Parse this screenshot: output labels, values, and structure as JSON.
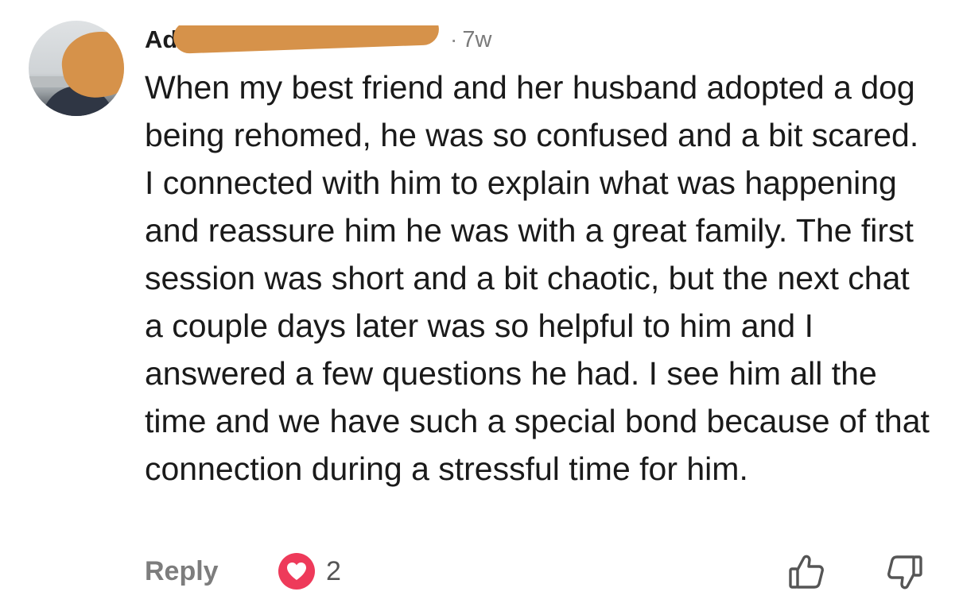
{
  "comment": {
    "author_visible": "Ad",
    "separator": "·",
    "time": "7w",
    "text": "When my best friend and her husband adopted a dog being rehomed, he was so confused and a bit scared. I connected with him to explain what was happening and reassure him he was with a great family. The first session was short and a bit chaotic, but the next chat a couple days later was so helpful to him and I answered a few questions he had. I see him all the time and we have such a special bond because of that connection during a stressful time for him."
  },
  "actions": {
    "reply_label": "Reply",
    "reaction_count": "2",
    "reaction_icon": "heart-icon",
    "like_icon": "thumbs-up-icon",
    "dislike_icon": "thumbs-down-icon"
  },
  "colors": {
    "redaction": "#d6924a",
    "heart_badge": "#ee3a5a",
    "muted_text": "#7d7d7d"
  }
}
